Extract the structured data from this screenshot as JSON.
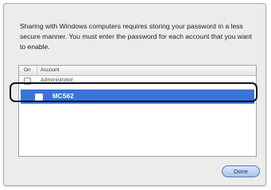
{
  "dialog": {
    "message": "Sharing with Windows computers requires storing your password in a less secure manner. You must enter the password for each account that you want to enable."
  },
  "account_list": {
    "columns": {
      "on": "On",
      "account": "Account"
    },
    "rows": [
      {
        "name": "Administrator",
        "enabled": false,
        "selected": false
      },
      {
        "name": "MCS62",
        "enabled": false,
        "selected": true
      }
    ]
  },
  "buttons": {
    "done": "Done"
  },
  "colors": {
    "selection": "#3874d8",
    "annotation_ring": "#111111"
  }
}
